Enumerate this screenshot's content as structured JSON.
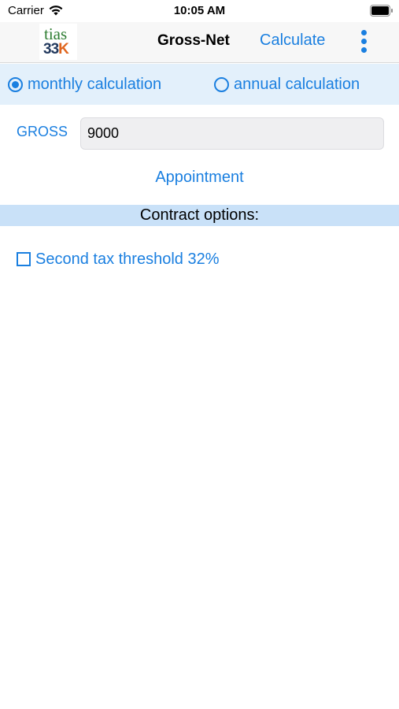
{
  "status_bar": {
    "carrier": "Carrier",
    "time": "10:05 AM"
  },
  "nav": {
    "logo_top": "tias",
    "logo_bottom_a": "33",
    "logo_bottom_b": "K",
    "title": "Gross-Net",
    "calculate_label": "Calculate",
    "more_icon": "more-vertical-icon"
  },
  "calc_type": {
    "monthly_label": "monthly calculation",
    "annual_label": "annual calculation",
    "selected": "monthly"
  },
  "gross": {
    "label": "GROSS",
    "value": "9000"
  },
  "appointment_label": "Appointment",
  "contract": {
    "header": "Contract options:",
    "second_tax_label": "Second tax threshold 32%",
    "second_tax_checked": false
  },
  "colors": {
    "accent": "#1a7fe0",
    "section_bg": "#e3f0fb",
    "header_bg": "#c9e1f8"
  }
}
